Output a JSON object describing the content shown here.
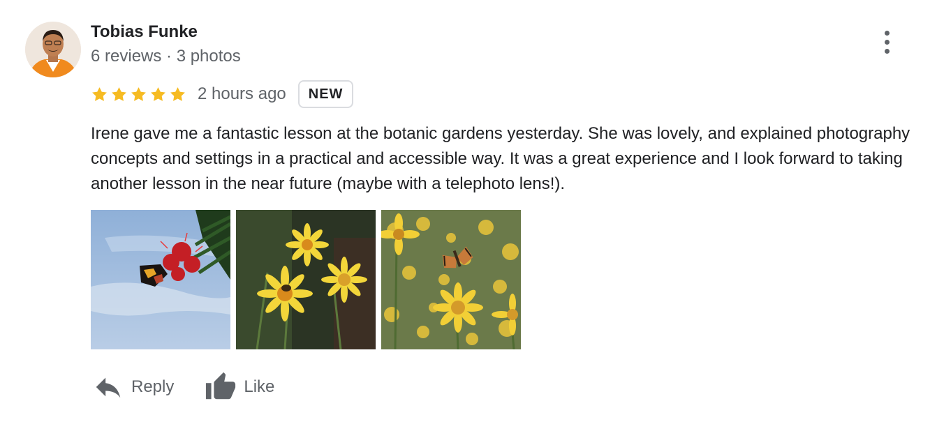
{
  "author": {
    "name": "Tobias Funke",
    "meta": "6 reviews · 3 photos",
    "avatar_icon": "profile-photo"
  },
  "menu": {
    "icon": "more-vert-icon"
  },
  "rating": {
    "stars": 5,
    "max_stars": 5,
    "star_color": "#f6bb22",
    "time": "2 hours ago",
    "badge": "NEW"
  },
  "review": {
    "text": "Irene gave me a fantastic lesson at the botanic gardens yesterday. She was lovely, and explained photography concepts and settings in a practical and accessible way. It was a great experience and I look forward to taking another lesson in the near future (maybe with a telephoto lens!)."
  },
  "photos": [
    {
      "subject": "butterfly on red bottlebrush flower against blue sky"
    },
    {
      "subject": "bee on yellow daisies"
    },
    {
      "subject": "butterfly over field of yellow daisies"
    }
  ],
  "actions": {
    "reply_label": "Reply",
    "like_label": "Like",
    "icon_color": "#5f6368"
  }
}
